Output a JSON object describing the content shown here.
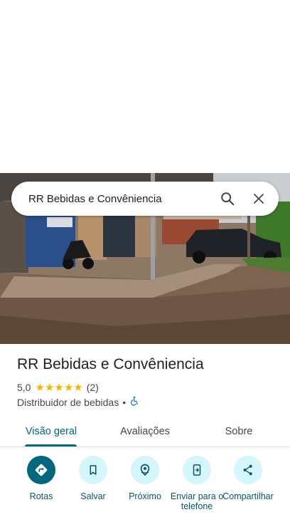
{
  "search": {
    "query": "RR Bebidas e Convênien​cia"
  },
  "place": {
    "name": "RR Bebidas e Convênien​cia",
    "rating": "5,0",
    "star_count": 5,
    "reviews": "(2)",
    "category": "Distribuidor de bebidas",
    "separator": "•"
  },
  "tabs": [
    {
      "label": "Visão geral",
      "active": true
    },
    {
      "label": "Avaliações",
      "active": false
    },
    {
      "label": "Sobre",
      "active": false
    }
  ],
  "actions": [
    {
      "label": "Rotas",
      "icon": "directions-icon"
    },
    {
      "label": "Salvar",
      "icon": "bookmark-icon"
    },
    {
      "label": "Próximo",
      "icon": "nearby-icon"
    },
    {
      "label": "Enviar para o telefone",
      "icon": "send-to-phone-icon"
    },
    {
      "label": "Compartilhar",
      "icon": "share-icon"
    }
  ],
  "colors": {
    "accent": "#00677d",
    "action_bg": "#d4f6fd",
    "star": "#f6b400"
  }
}
